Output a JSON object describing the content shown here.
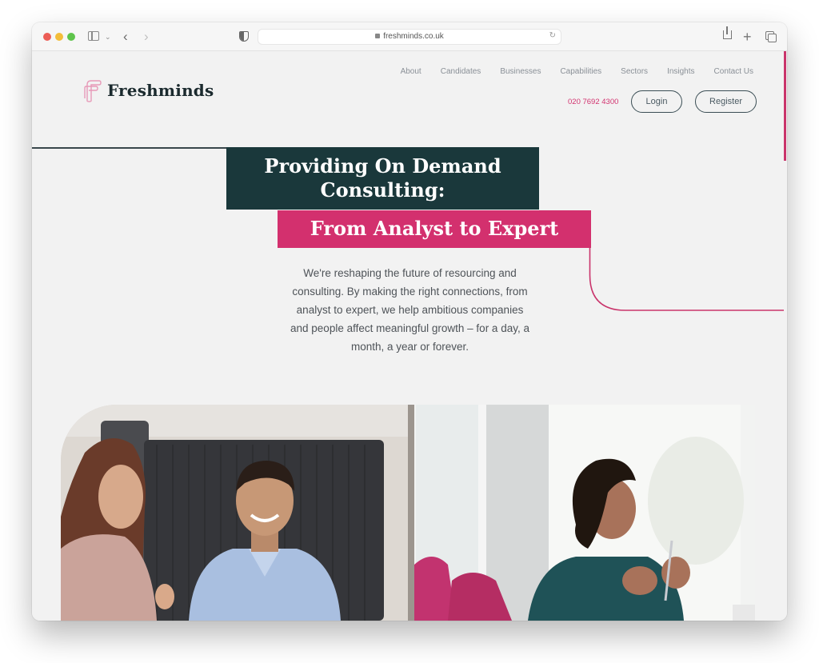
{
  "browser": {
    "url": "freshminds.co.uk",
    "icons": [
      "sidebar-icon",
      "chevron-down-icon",
      "back-icon",
      "forward-icon",
      "shield-icon",
      "lock-icon",
      "reload-icon",
      "share-icon",
      "new-tab-icon",
      "tabs-overview-icon"
    ],
    "back_glyph": "‹",
    "forward_glyph": "›",
    "chevron_glyph": "⌄",
    "reload_glyph": "↻",
    "plus_glyph": "+"
  },
  "site": {
    "brand": "Freshminds",
    "logo_icon": "freshminds-f-logo",
    "nav": [
      {
        "label": "About"
      },
      {
        "label": "Candidates"
      },
      {
        "label": "Businesses"
      },
      {
        "label": "Capabilities"
      },
      {
        "label": "Sectors"
      },
      {
        "label": "Insights"
      },
      {
        "label": "Contact Us"
      }
    ],
    "phone": "020 7692 4300",
    "login_label": "Login",
    "register_label": "Register"
  },
  "hero": {
    "title_line1": "Providing On Demand",
    "title_line2": "Consulting:",
    "subtitle": "From Analyst to Expert",
    "intro": "We're reshaping the future of resourcing and consulting. By making the right connections, from analyst to expert, we help ambitious companies and people affect meaningful growth – for a day, a month, a year or forever."
  },
  "images": [
    {
      "alt": "Woman talking with smiling man in a blue shirt in an office booth"
    },
    {
      "alt": "Woman in a teal top holding a pen, looking to the side"
    }
  ],
  "colors": {
    "accent_pink": "#d3306e",
    "dark_teal": "#1a383b",
    "page_bg": "#f2f2f2",
    "text_grey": "#4e5358"
  }
}
